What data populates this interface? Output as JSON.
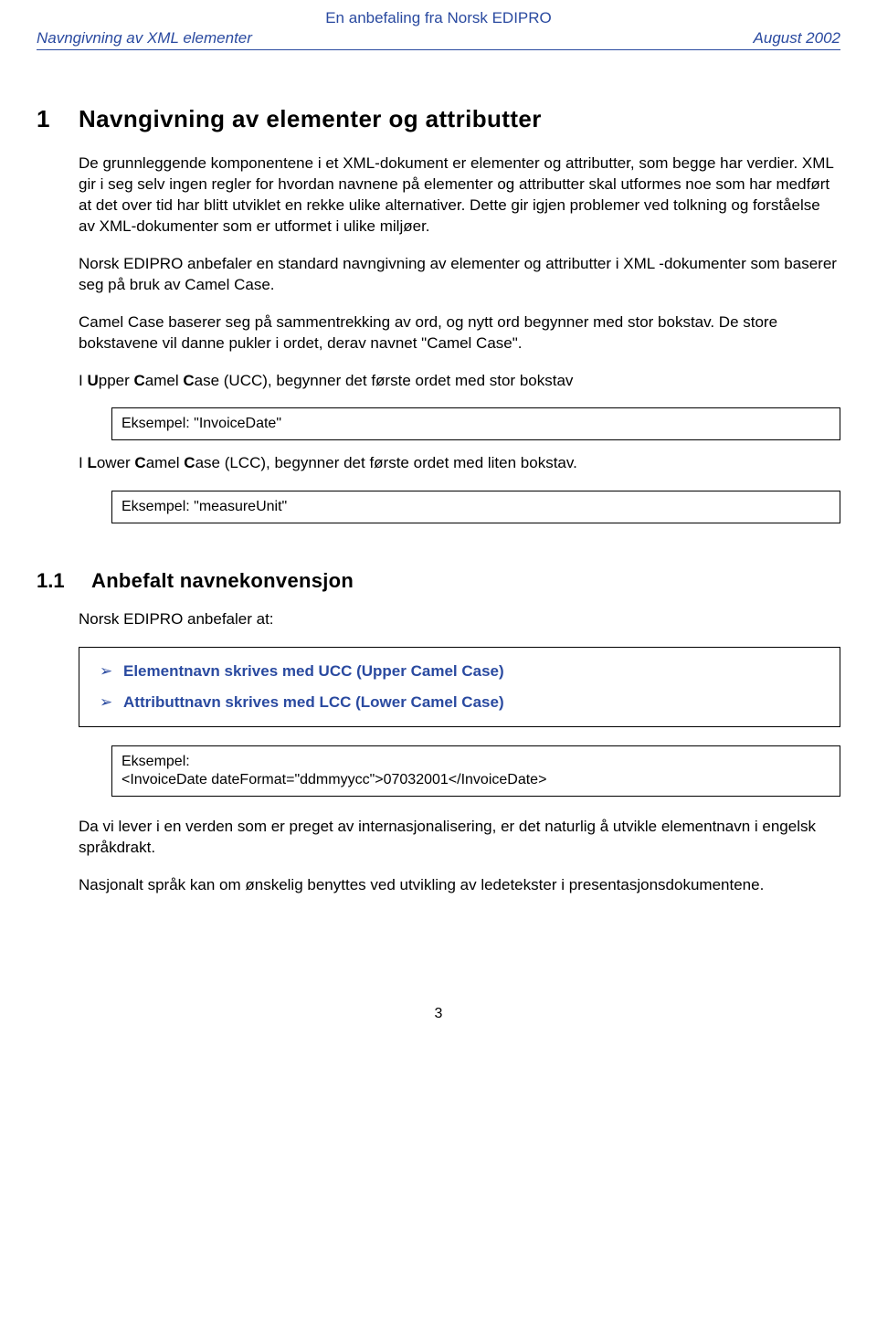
{
  "header": {
    "top": "En anbefaling fra Norsk EDIPRO",
    "left": "Navngivning av XML elementer",
    "right": "August 2002"
  },
  "sec1": {
    "num": "1",
    "title": "Navngivning av elementer og attributter",
    "p1": "De grunnleggende komponentene i et XML-dokument er elementer og attributter, som begge har verdier. XML gir i seg selv ingen regler for hvordan navnene på elementer og attributter skal utformes noe som har medført at det over tid har blitt utviklet en rekke ulike alternativer. Dette gir igjen problemer ved tolkning og forståelse av XML-dokumenter som er utformet i ulike miljøer.",
    "p2": "Norsk EDIPRO anbefaler en standard navngivning av elementer og attributter i XML -dokumenter som baserer seg på bruk av Camel Case.",
    "p3": "Camel Case baserer seg på sammentrekking av ord, og nytt ord begynner med stor bokstav. De store bokstavene vil danne pukler i ordet, derav navnet \"Camel Case\".",
    "p4_pre": "I ",
    "p4_u": "U",
    "p4_mid1": "pper ",
    "p4_c": "C",
    "p4_mid2": "amel ",
    "p4_c2": "C",
    "p4_post": "ase (UCC), begynner det første ordet med stor bokstav",
    "ex1": "Eksempel: \"InvoiceDate\"",
    "p5_pre": "I ",
    "p5_l": "L",
    "p5_mid1": "ower ",
    "p5_c": "C",
    "p5_mid2": "amel ",
    "p5_c2": "C",
    "p5_post": "ase (LCC), begynner det første ordet med liten bokstav.",
    "ex2": "Eksempel: \"measureUnit\""
  },
  "sec11": {
    "num": "1.1",
    "title": "Anbefalt navnekonvensjon",
    "intro": "Norsk EDIPRO anbefaler at:",
    "rec1": "Elementnavn skrives med UCC (Upper Camel Case)",
    "rec2": "Attributtnavn skrives med LCC (Lower Camel Case)",
    "ex_label": "Eksempel:",
    "ex_code": "<InvoiceDate dateFormat=\"ddmmyycc\">07032001</InvoiceDate>",
    "p1": "Da vi lever i en verden som er preget av internasjonalisering, er det naturlig å utvikle elementnavn  i engelsk språkdrakt.",
    "p2": "Nasjonalt språk kan om ønskelig benyttes ved utvikling av ledetekster i presentasjonsdokumentene."
  },
  "page_number": "3"
}
